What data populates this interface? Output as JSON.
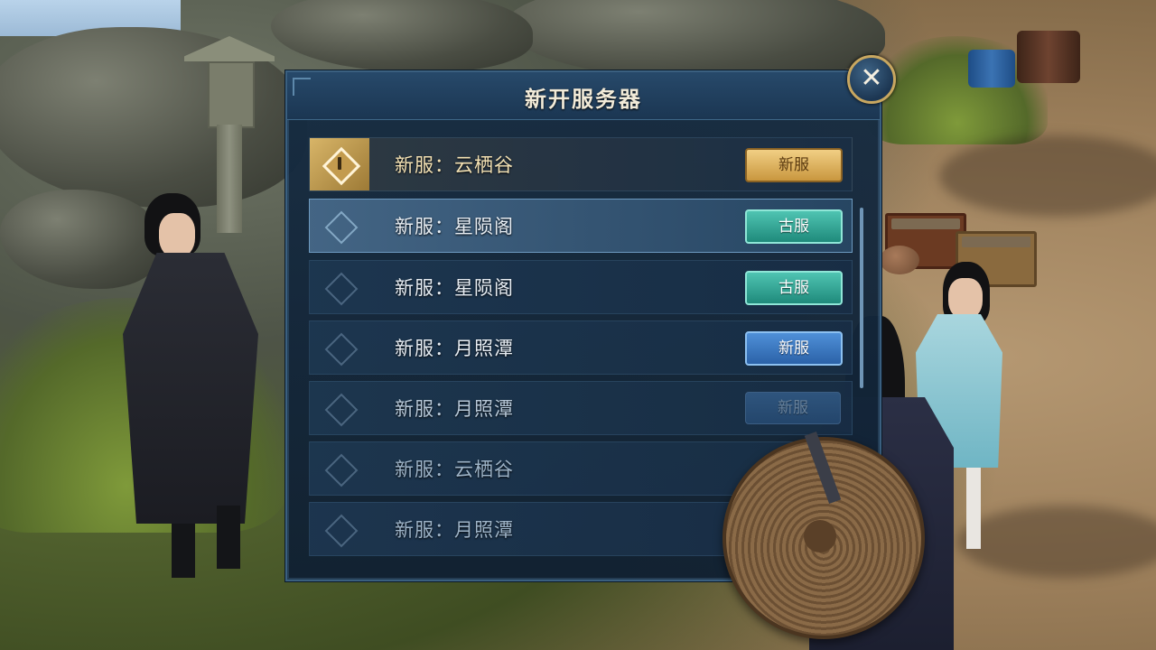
{
  "dialog": {
    "title": "新开服务器",
    "close_label": "✕"
  },
  "servers": [
    {
      "name": "新服：云栖谷",
      "tag": "新服",
      "tag_style": "gold",
      "state": "highlighted"
    },
    {
      "name": "新服：星陨阁",
      "tag": "古服",
      "tag_style": "teal",
      "state": "selected"
    },
    {
      "name": "新服：星陨阁",
      "tag": "古服",
      "tag_style": "teal",
      "state": "normal"
    },
    {
      "name": "新服：月照潭",
      "tag": "新服",
      "tag_style": "blue",
      "state": "normal"
    },
    {
      "name": "新服：月照潭",
      "tag": "新服",
      "tag_style": "dim",
      "state": "faded"
    },
    {
      "name": "新服：云栖谷",
      "tag": "",
      "tag_style": "none",
      "state": "faded"
    },
    {
      "name": "新服：月照潭",
      "tag": "",
      "tag_style": "none",
      "state": "faded"
    }
  ],
  "icons": {
    "close": "close-icon",
    "row_marker": "diamond-icon"
  },
  "colors": {
    "gold_badge": "#d8ac5a",
    "teal_badge": "#2fa594",
    "blue_badge": "#3a78c0",
    "panel_bg": "#162c42"
  }
}
